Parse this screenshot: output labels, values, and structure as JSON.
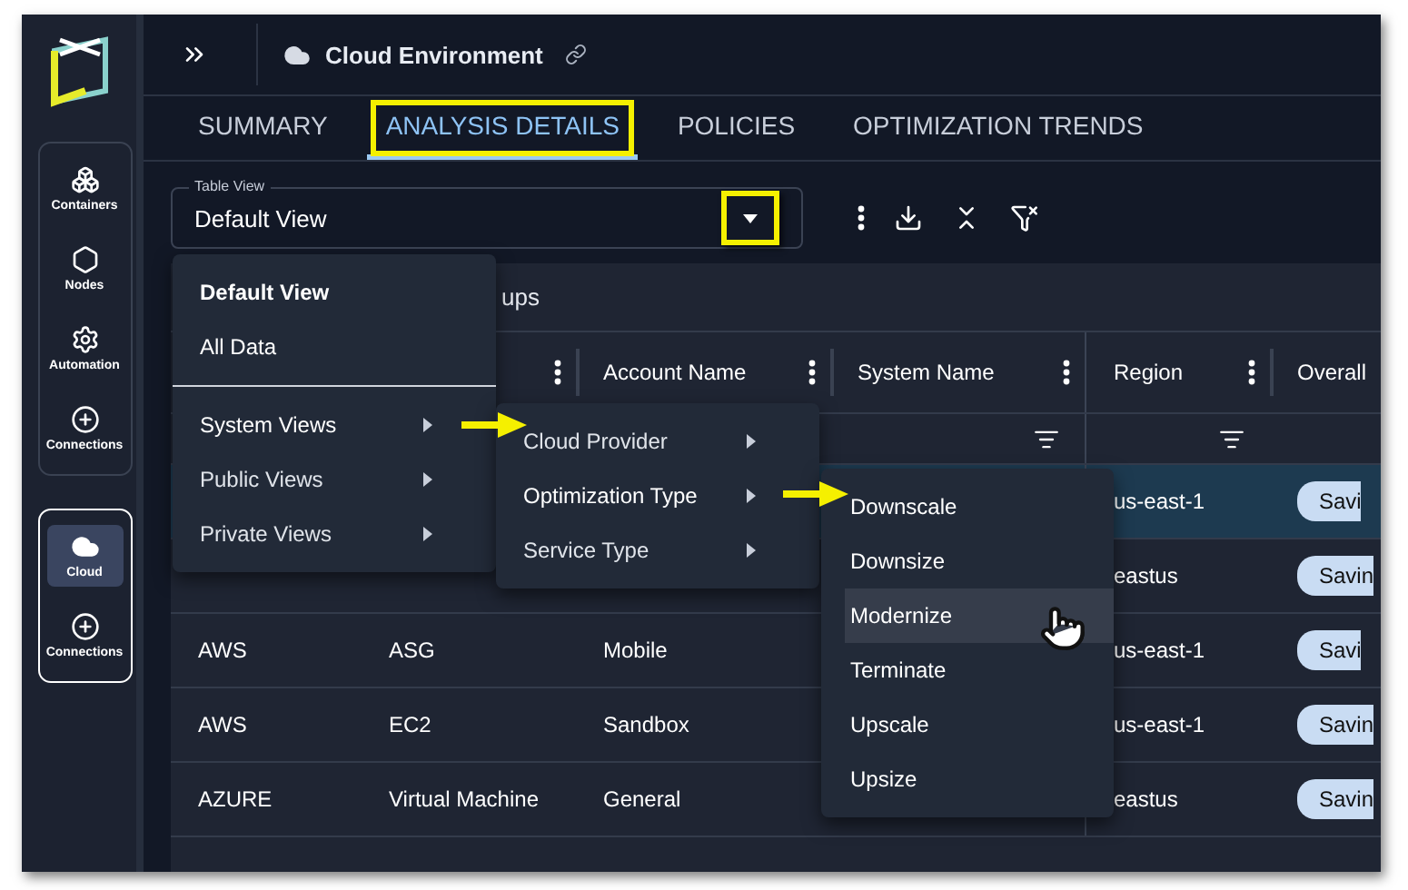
{
  "sidebar": {
    "groups": [
      {
        "outlined": false,
        "items": [
          {
            "label": "Containers",
            "kind": "boxes",
            "selected": false
          },
          {
            "label": "Nodes",
            "kind": "hexagons",
            "selected": false
          },
          {
            "label": "Automation",
            "kind": "gear",
            "selected": false
          },
          {
            "label": "Connections",
            "kind": "plus",
            "selected": false
          }
        ]
      },
      {
        "outlined": true,
        "items": [
          {
            "label": "Cloud",
            "kind": "cloud",
            "selected": true
          },
          {
            "label": "Connections",
            "kind": "plus",
            "selected": false
          }
        ]
      }
    ]
  },
  "header": {
    "title": "Cloud Environment"
  },
  "tabs": [
    {
      "label": "SUMMARY",
      "selected": false,
      "highlighted": false
    },
    {
      "label": "ANALYSIS DETAILS",
      "selected": true,
      "highlighted": true
    },
    {
      "label": "POLICIES",
      "selected": false,
      "highlighted": false
    },
    {
      "label": "OPTIMIZATION TRENDS",
      "selected": false,
      "highlighted": false
    }
  ],
  "table_view": {
    "label": "Table View",
    "value": "Default View",
    "caret_highlighted": true
  },
  "table": {
    "group_bar": "ups",
    "columns": [
      {
        "menu": true
      },
      {
        "label": "Account Name",
        "menu": true
      },
      {
        "label": "System Name",
        "menu": true,
        "filter": true
      },
      {
        "label": "Region",
        "menu": true,
        "filter": true
      },
      {
        "label": "Overall"
      }
    ],
    "rows": [
      {
        "selected": true,
        "region": "us-east-1",
        "savings": "Savi"
      },
      {
        "selected": false,
        "region": "eastus",
        "savings": "Savin"
      },
      {
        "selected": false,
        "provider": "AWS",
        "service": "ASG",
        "account": "Mobile",
        "region": "us-east-1",
        "savings": "Savi"
      },
      {
        "selected": false,
        "provider": "AWS",
        "service": "EC2",
        "account": "Sandbox",
        "region": "us-east-1",
        "savings": "Savin"
      },
      {
        "selected": false,
        "provider": "AZURE",
        "service": "Virtual Machine",
        "account": "General",
        "region": "eastus",
        "savings": "Savin"
      }
    ]
  },
  "view_menu": {
    "items": [
      {
        "kind": "option",
        "label": "Default View",
        "selected": true
      },
      {
        "kind": "option",
        "label": "All Data",
        "selected": false
      },
      {
        "kind": "divider"
      },
      {
        "kind": "submenu",
        "label": "System Views",
        "expanded": true
      },
      {
        "kind": "submenu",
        "label": "Public Views",
        "expanded": false
      },
      {
        "kind": "submenu",
        "label": "Private Views",
        "expanded": false
      }
    ]
  },
  "system_views_menu": {
    "items": [
      {
        "label": "Cloud Provider",
        "expanded": false
      },
      {
        "label": "Optimization Type",
        "expanded": true
      },
      {
        "label": "Service Type",
        "expanded": false
      }
    ]
  },
  "optimization_type_menu": {
    "items": [
      {
        "label": "Downscale",
        "hovered": false
      },
      {
        "label": "Downsize",
        "hovered": false
      },
      {
        "label": "Modernize",
        "hovered": true
      },
      {
        "label": "Terminate",
        "hovered": false
      },
      {
        "label": "Upscale",
        "hovered": false
      },
      {
        "label": "Upsize",
        "hovered": false
      }
    ]
  }
}
